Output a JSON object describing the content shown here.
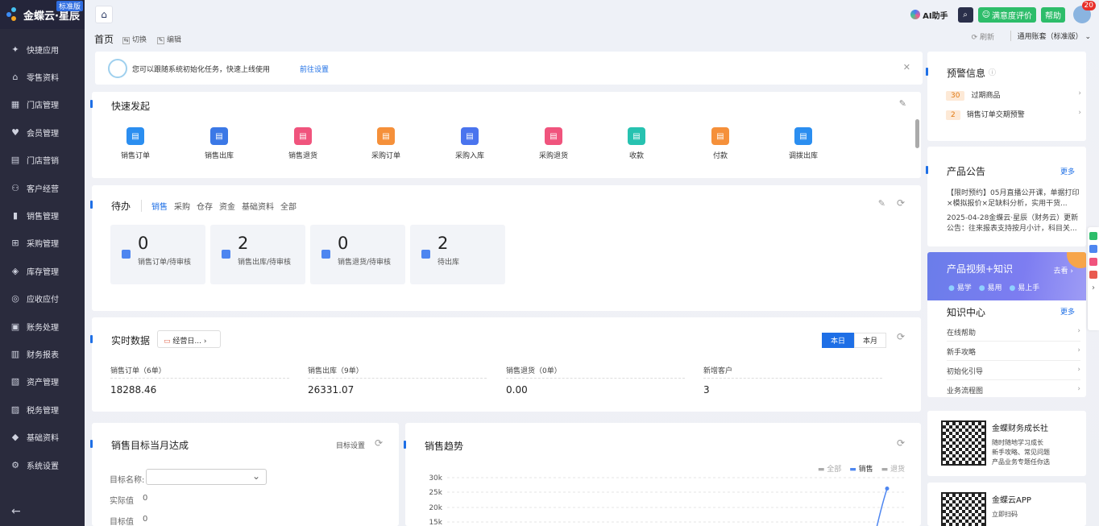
{
  "brand": {
    "name": "金蝶云·星辰",
    "badge": "标准版"
  },
  "sidebar": {
    "items": [
      {
        "label": "快捷应用",
        "icon": "apps-icon"
      },
      {
        "label": "零售资料",
        "icon": "basket-icon"
      },
      {
        "label": "门店管理",
        "icon": "store-icon"
      },
      {
        "label": "会员管理",
        "icon": "member-icon"
      },
      {
        "label": "门店营销",
        "icon": "marketing-icon"
      },
      {
        "label": "客户经营",
        "icon": "customer-icon"
      },
      {
        "label": "销售管理",
        "icon": "sales-icon"
      },
      {
        "label": "采购管理",
        "icon": "cart-icon"
      },
      {
        "label": "库存管理",
        "icon": "inventory-icon"
      },
      {
        "label": "应收应付",
        "icon": "receivable-icon"
      },
      {
        "label": "账务处理",
        "icon": "ledger-icon"
      },
      {
        "label": "财务报表",
        "icon": "report-icon"
      },
      {
        "label": "资产管理",
        "icon": "asset-icon"
      },
      {
        "label": "税务管理",
        "icon": "tax-icon"
      },
      {
        "label": "基础资料",
        "icon": "layers-icon"
      },
      {
        "label": "系统设置",
        "icon": "settings-icon"
      }
    ]
  },
  "topbar": {
    "ai": "AI助手",
    "satisfaction": "满意度评价",
    "help": "帮助",
    "notifications": "20"
  },
  "subbar": {
    "title": "首页",
    "switch": "切换",
    "edit": "编辑",
    "refresh": "刷新",
    "account": "通用账套（标准版）"
  },
  "notice": {
    "message": "您可以跟随系统初始化任务，快速上线使用",
    "link": "前往设置"
  },
  "quick": {
    "title": "快速发起",
    "items": [
      {
        "label": "销售订单",
        "color": "#2b8ef0"
      },
      {
        "label": "销售出库",
        "color": "#3b78e6"
      },
      {
        "label": "销售退货",
        "color": "#f0547d"
      },
      {
        "label": "采购订单",
        "color": "#f5903a"
      },
      {
        "label": "采购入库",
        "color": "#4a74ee"
      },
      {
        "label": "采购退货",
        "color": "#f0547d"
      },
      {
        "label": "收款",
        "color": "#27c2b0"
      },
      {
        "label": "付款",
        "color": "#f5903a"
      },
      {
        "label": "调拨出库",
        "color": "#2b8ef0"
      }
    ]
  },
  "todo": {
    "title": "待办",
    "tabs": [
      "销售",
      "采购",
      "仓存",
      "资金",
      "基础资料",
      "全部"
    ],
    "boxes": [
      {
        "num": "0",
        "label": "销售订单/待审核"
      },
      {
        "num": "2",
        "label": "销售出库/待审核"
      },
      {
        "num": "0",
        "label": "销售退货/待审核"
      },
      {
        "num": "2",
        "label": "待出库"
      }
    ]
  },
  "realtime": {
    "title": "实时数据",
    "selector": "经营日...",
    "today": "本日",
    "month": "本月",
    "metrics": [
      {
        "label": "销售订单（6单）",
        "value": "18288.46"
      },
      {
        "label": "销售出库（9单）",
        "value": "26331.07"
      },
      {
        "label": "销售退货（0单）",
        "value": "0.00"
      },
      {
        "label": "新增客户",
        "value": "3"
      }
    ]
  },
  "target": {
    "title": "销售目标当月达成",
    "settings": "目标设置",
    "name_label": "目标名称:",
    "actual_label": "实际值",
    "actual_value": "0",
    "target_label": "目标值",
    "target_value": "0"
  },
  "trend": {
    "title": "销售趋势",
    "legend": [
      "全部",
      "销售",
      "退货"
    ]
  },
  "chart_data": {
    "type": "line",
    "title": "销售趋势",
    "y_ticks": [
      "30k",
      "25k",
      "20k",
      "15k"
    ],
    "series": [
      {
        "name": "销售",
        "values": [
          26331.07
        ]
      }
    ]
  },
  "warn": {
    "title": "预警信息",
    "rows": [
      {
        "count": "30",
        "label": "过期商品"
      },
      {
        "count": "2",
        "label": "销售订单交期预警"
      }
    ]
  },
  "announce": {
    "title": "产品公告",
    "more": "更多",
    "items": [
      "【限时预约】05月直播公开课，单据打印×模拟报价×足缺料分析，实用干货...",
      "2025-04-28金蝶云·星辰（财务云）更新公告：往来报表支持按月小计，科目关..."
    ]
  },
  "video": {
    "title": "产品视频+知识",
    "go": "去看",
    "tags": [
      "易学",
      "易用",
      "易上手"
    ]
  },
  "knowledge": {
    "title": "知识中心",
    "more": "更多",
    "items": [
      "在线帮助",
      "新手攻略",
      "初始化引导",
      "业务流程图"
    ]
  },
  "qr1": {
    "title": "金蝶财务成长社",
    "lines": [
      "随时随地学习成长",
      "新手攻略、常见问题",
      "产品业务专题任你选"
    ]
  },
  "qr2": {
    "title": "金蝶云APP",
    "lines": [
      "立即扫码"
    ]
  }
}
